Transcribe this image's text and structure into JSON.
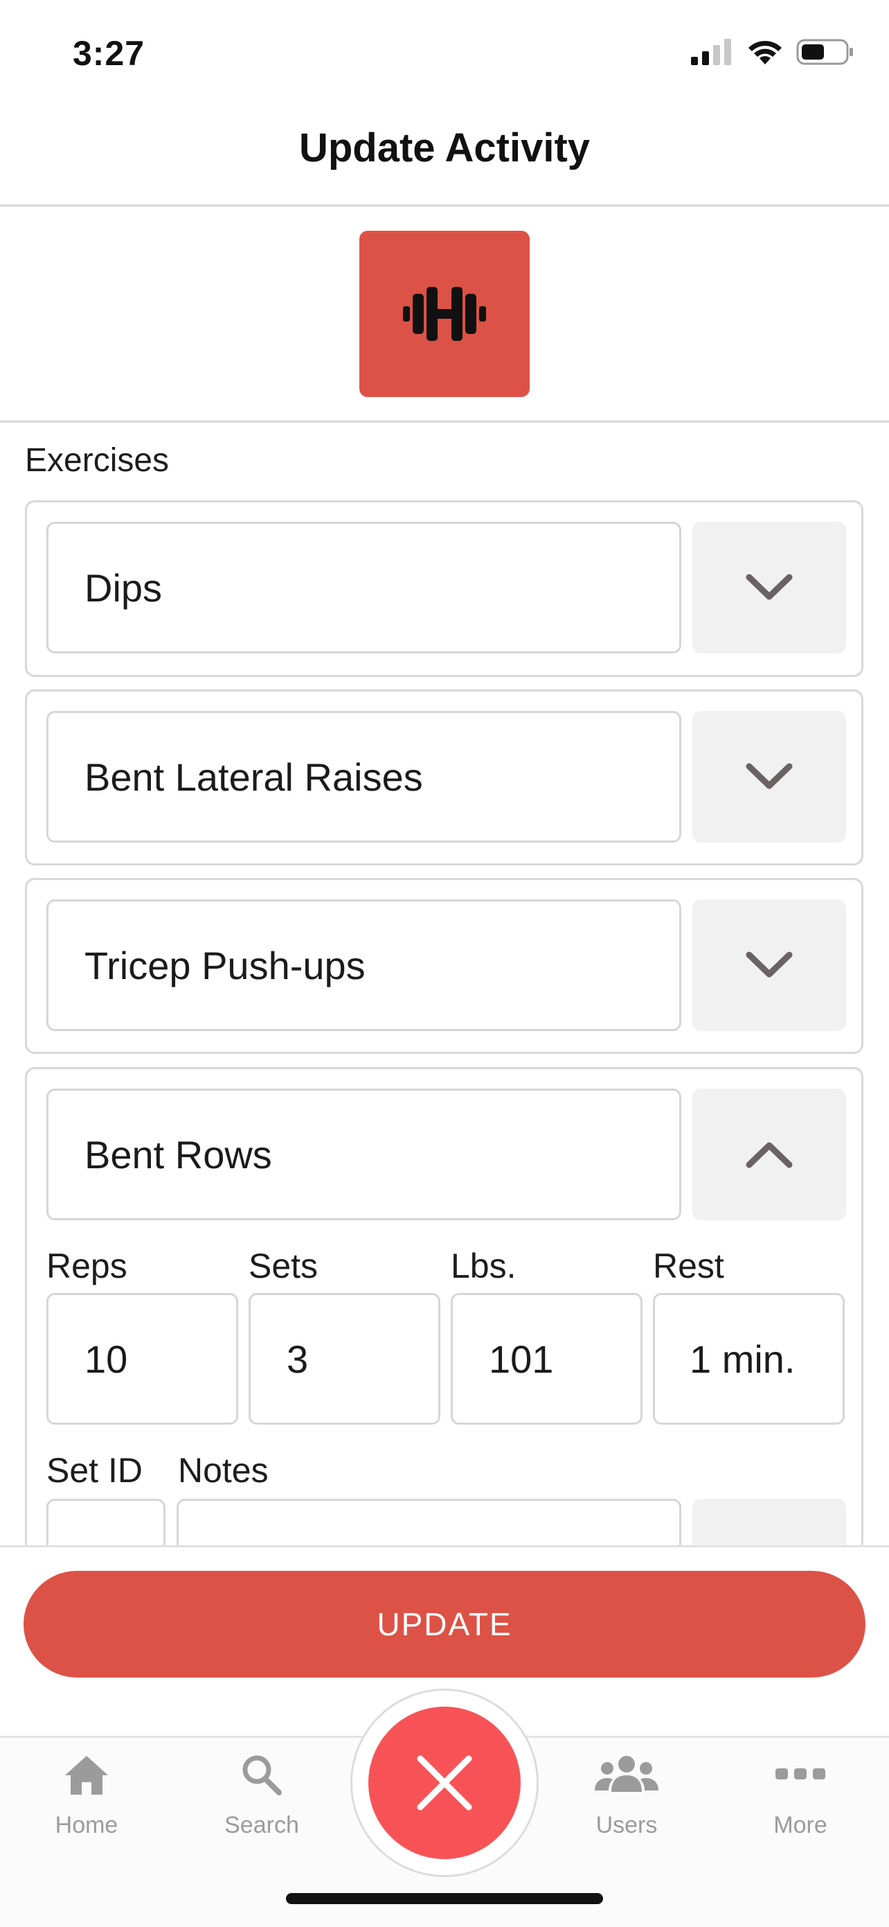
{
  "status_bar": {
    "time": "3:27"
  },
  "header": {
    "title": "Update Activity"
  },
  "activity": {
    "icon": "dumbbell-icon",
    "accent_color": "#dd5246"
  },
  "exercises_section": {
    "label": "Exercises",
    "items": [
      {
        "name": "Dips",
        "toggle_icon": "chevron-down-icon"
      },
      {
        "name": "Bent Lateral Raises",
        "toggle_icon": "chevron-down-icon"
      },
      {
        "name": "Tricep Push-ups",
        "toggle_icon": "chevron-down-icon"
      },
      {
        "name": "Bent Rows",
        "toggle_icon": "chevron-up-icon",
        "details": {
          "reps_label": "Reps",
          "reps": "10",
          "sets_label": "Sets",
          "sets": "3",
          "lbs_label": "Lbs.",
          "lbs": "101",
          "rest_label": "Rest",
          "rest": "1 min.",
          "set_id_label": "Set ID",
          "notes_label": "Notes"
        }
      }
    ]
  },
  "actions": {
    "update_label": "UPDATE",
    "button_color": "#dd5246"
  },
  "tab_bar": {
    "items": [
      {
        "label": "Home",
        "icon": "home-icon"
      },
      {
        "label": "Search",
        "icon": "search-icon"
      },
      {
        "label": "Users",
        "icon": "users-icon"
      },
      {
        "label": "More",
        "icon": "more-icon"
      }
    ],
    "center_action": {
      "icon": "close-icon",
      "color": "#f75357"
    }
  }
}
